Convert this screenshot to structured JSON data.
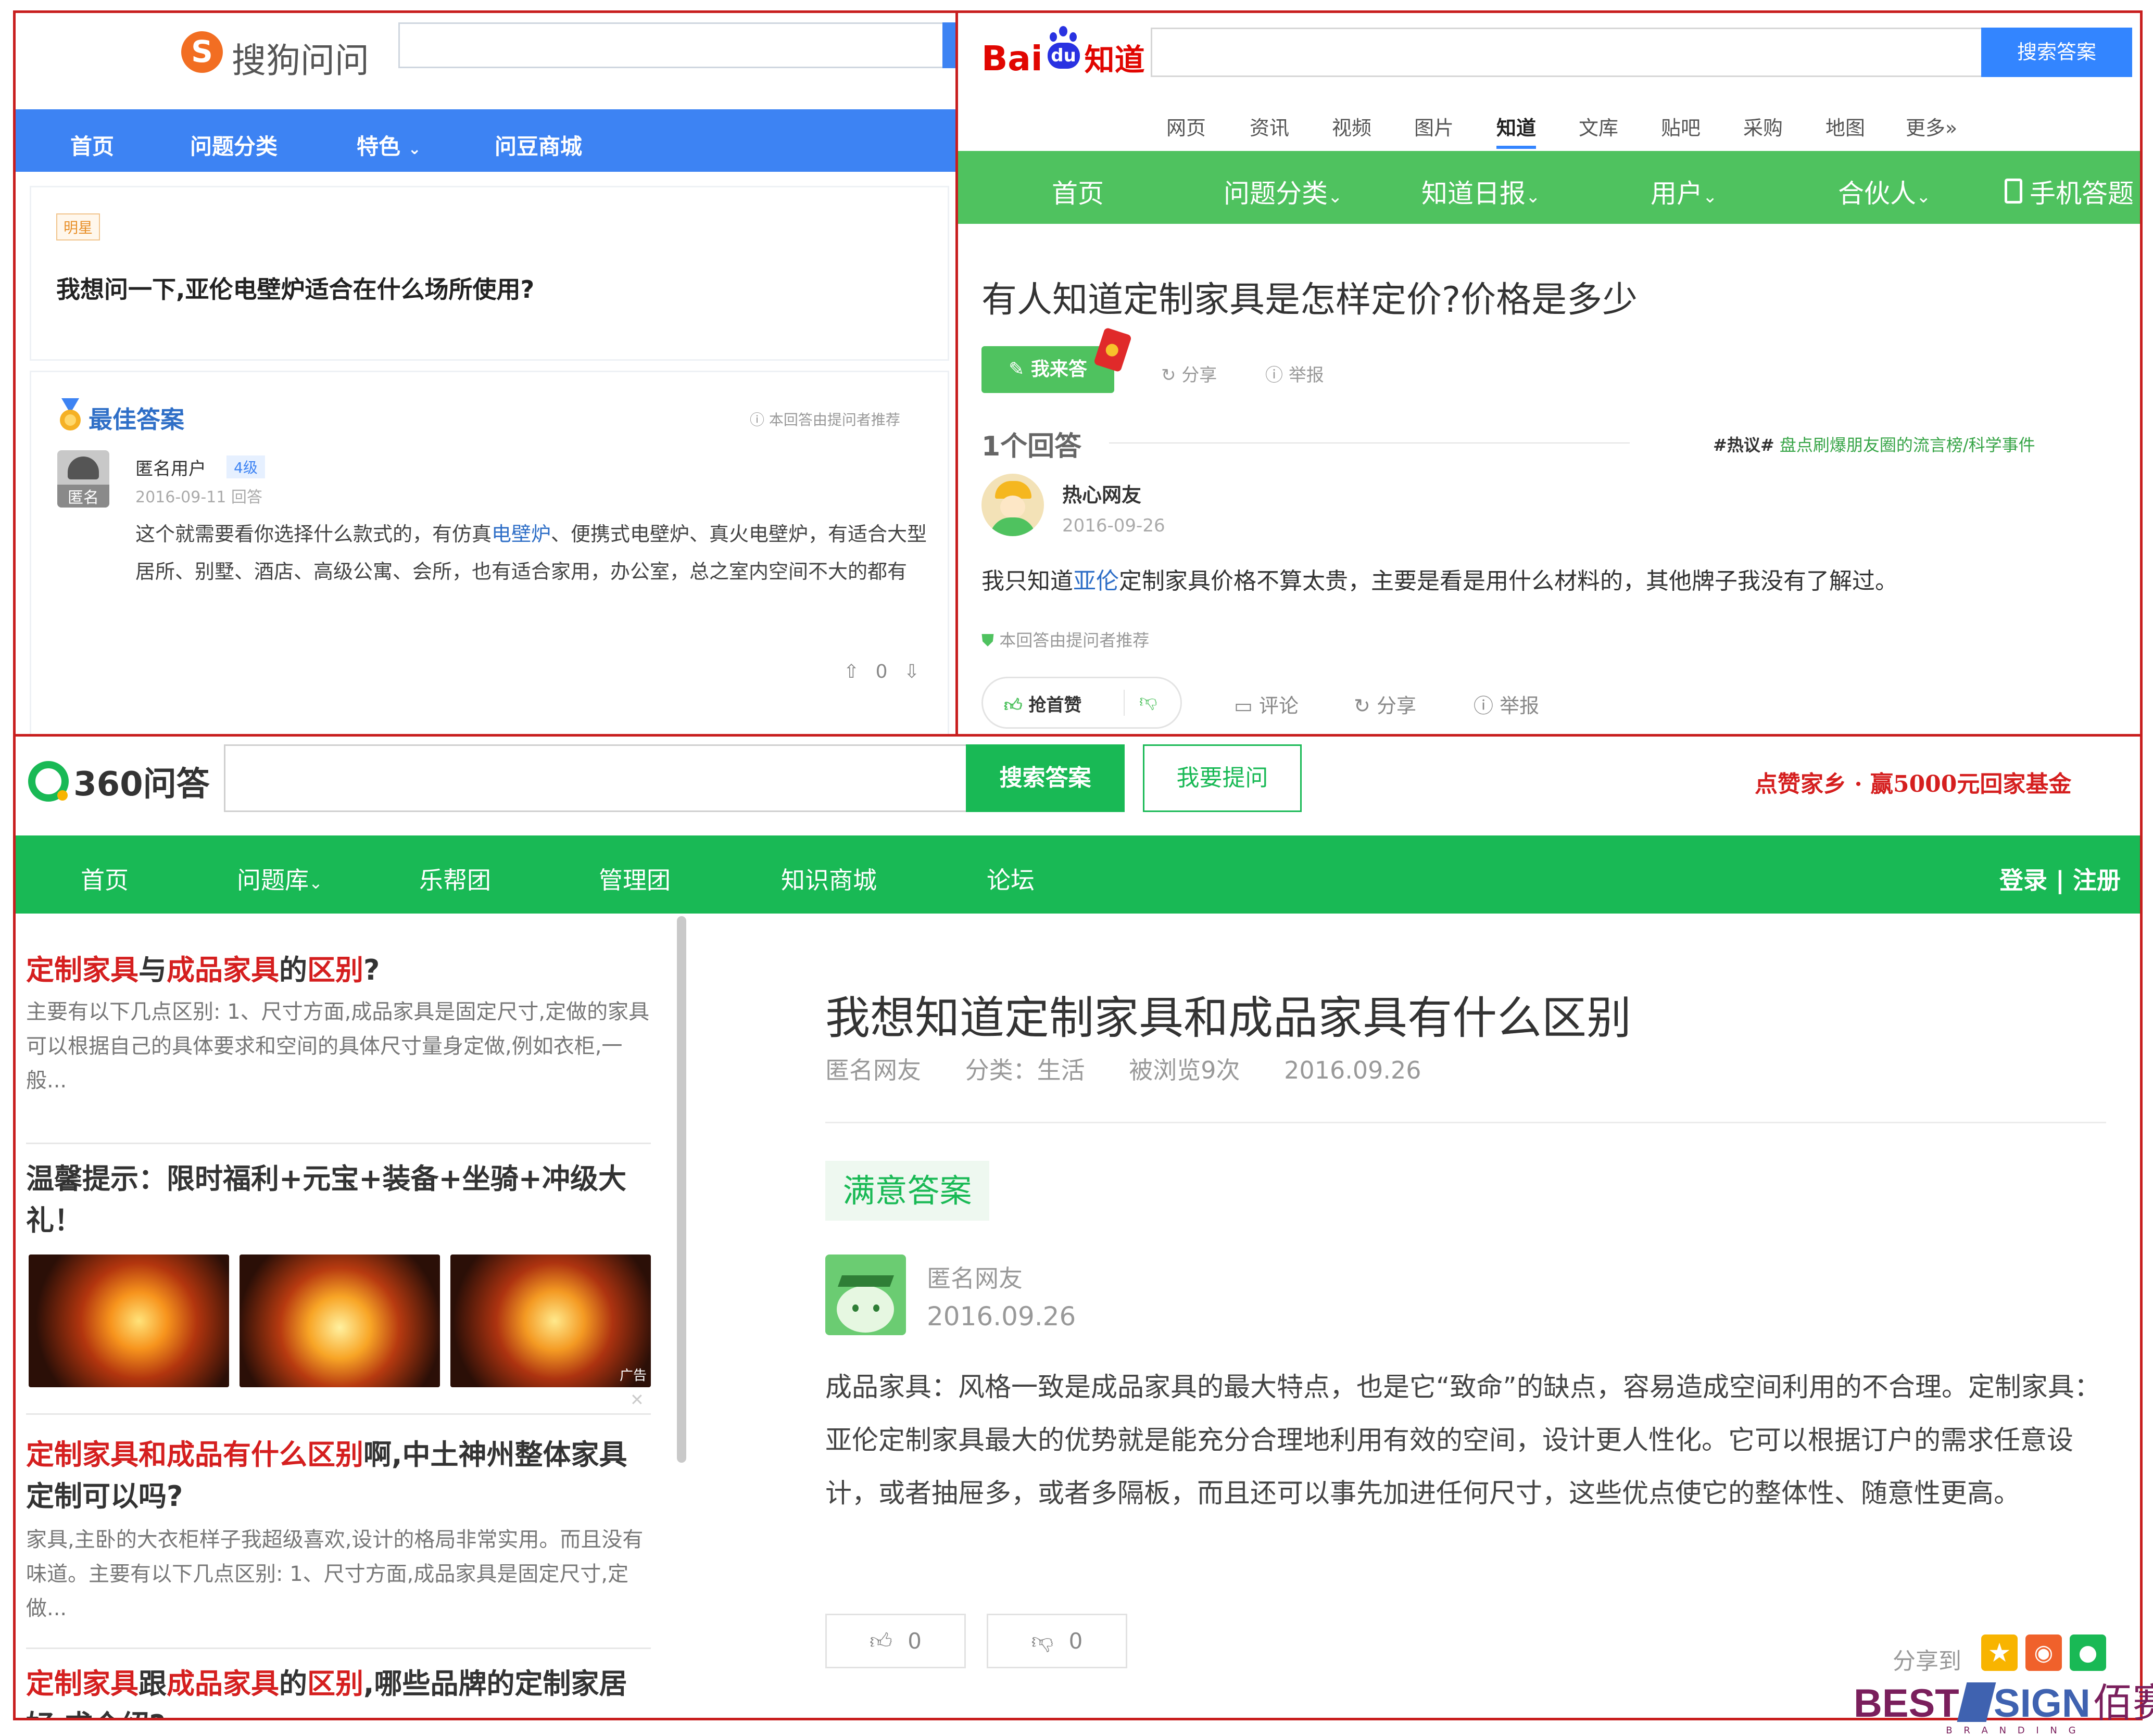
{
  "sogou": {
    "logo_text": "搜狗问问",
    "nav": [
      "首页",
      "问题分类",
      "特色",
      "问豆商城"
    ],
    "tag": "明星",
    "question": "我想问一下,亚伦电壁炉适合在什么场所使用?",
    "best_answer_label": "最佳答案",
    "recommend_note": "本回答由提问者推荐",
    "avatar_label": "匿名",
    "user": "匿名用户",
    "level": "4级",
    "date": "2016-09-11 回答",
    "answer_pre": "这个就需要看你选择什么款式的，有仿真",
    "answer_link": "电壁炉",
    "answer_post": "、便携式电壁炉、真火电壁炉，有适合大型居所、别墅、酒店、高级公寓、会所，也有适合家用，办公室，总之室内空间不大的都有",
    "vote_count": "0"
  },
  "baidu": {
    "logo_text": "Bai",
    "logo_du": "du",
    "logo_zhidao": "知道",
    "search_button": "搜索答案",
    "tabs": [
      "网页",
      "资讯",
      "视频",
      "图片",
      "知道",
      "文库",
      "贴吧",
      "采购",
      "地图",
      "更多»"
    ],
    "nav": [
      "首页",
      "问题分类",
      "知道日报",
      "用户",
      "合伙人",
      "手机答题"
    ],
    "question": "有人知道定制家具是怎样定价?价格是多少",
    "answer_button": "我来答",
    "share": "分享",
    "report": "举报",
    "answer_count": "1个回答",
    "hot_tag": "#热议#",
    "hot_link": "盘点刷爆朋友圈的流言榜/科学事件",
    "user": "热心网友",
    "date": "2016-09-26",
    "answer_pre": "我只知道",
    "answer_link": "亚伦",
    "answer_post": "定制家具价格不算太贵，主要是看是用什么材料的，其他牌子我没有了解过。",
    "recommend_note": "本回答由提问者推荐",
    "like_button": "抢首赞",
    "comment": "评论",
    "share2": "分享",
    "report2": "举报"
  },
  "so360": {
    "logo_text": "360问答",
    "search_button": "搜索答案",
    "ask_button": "我要提问",
    "promo": "点赞家乡 · 赢5000元回家基金",
    "nav": [
      "首页",
      "问题库",
      "乐帮团",
      "管理团",
      "知识商城",
      "论坛"
    ],
    "login": "登录",
    "register": "注册",
    "sidebar": [
      {
        "title_parts": [
          [
            "定制家具",
            "red"
          ],
          [
            "与",
            "dark"
          ],
          [
            "成品家具",
            "red"
          ],
          [
            "的",
            "dark"
          ],
          [
            "区别",
            "red"
          ],
          [
            "?",
            "dark"
          ]
        ],
        "desc": "主要有以下几点区别: 1、尺寸方面,成品家具是固定尺寸,定做的家具可以根据自己的具体要求和空间的具体尺寸量身定做,例如衣柜,一般..."
      },
      {
        "title_parts": [
          [
            "温馨提示：限时福利+元宝+装备+坐骑+冲级大礼！",
            "dark"
          ]
        ],
        "ad_label": "广告"
      },
      {
        "title_parts": [
          [
            "定制家具和成品有什么区别",
            "red"
          ],
          [
            "啊,中土神州整体家具定制可以吗?",
            "dark"
          ]
        ],
        "desc": "家具,主卧的大衣柜样子我超级喜欢,设计的格局非常实用。而且没有味道。主要有以下几点区别: 1、尺寸方面,成品家具是固定尺寸,定做..."
      },
      {
        "title_parts": [
          [
            "定制家具",
            "red"
          ],
          [
            "跟",
            "dark"
          ],
          [
            "成品家具",
            "red"
          ],
          [
            "的",
            "dark"
          ],
          [
            "区别",
            "red"
          ],
          [
            ",哪些品牌的定制家居好,求介绍?",
            "dark"
          ]
        ]
      }
    ],
    "question": "我想知道定制家具和成品家具有什么区别",
    "meta": [
      "匿名网友",
      "分类：生活",
      "被浏览9次",
      "2016.09.26"
    ],
    "satisfied_label": "满意答案",
    "user": "匿名网友",
    "date": "2016.09.26",
    "answer": "成品家具：风格一致是成品家具的最大特点，也是它“致命”的缺点，容易造成空间利用的不合理。定制家具：亚伦定制家具最大的优势就是能充分合理地利用有效的空间，设计更人性化。它可以根据订户的需求任意设计，或者抽屉多，或者多隔板，而且还可以事先加进任何尺寸，这些优点使它的整体性、随意性更高。",
    "up_count": "0",
    "down_count": "0",
    "share_to": "分享到"
  },
  "watermark": {
    "best": "BEST",
    "sign": "SIGN",
    "cn": "佰赛",
    "sub": "B R A N D I N G"
  }
}
